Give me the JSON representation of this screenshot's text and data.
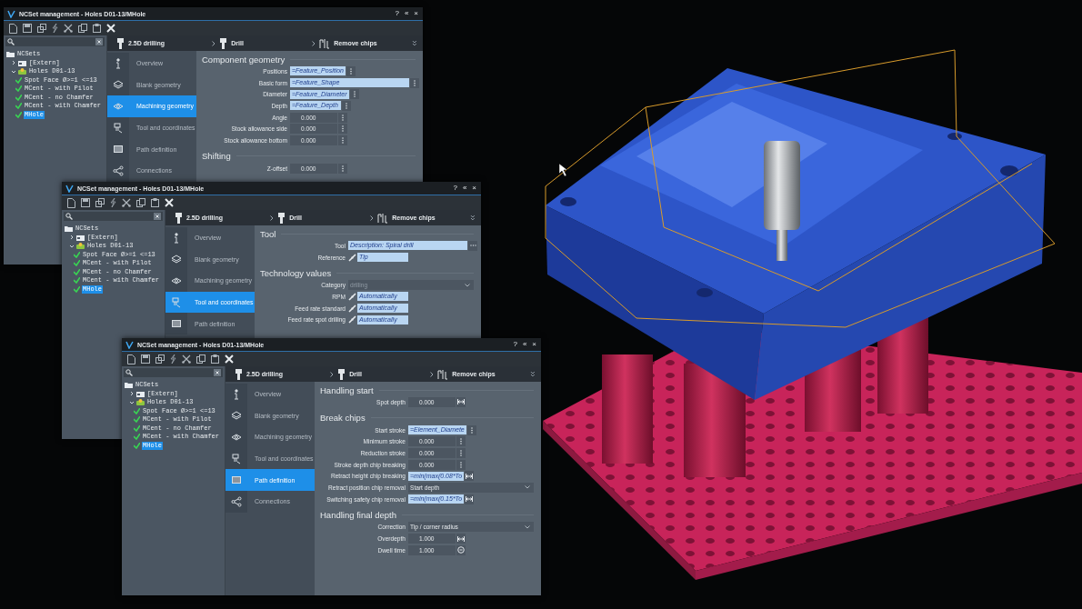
{
  "windows": [
    {
      "title": "NCSet management - Holes D01-13/MHole",
      "title_buttons": [
        "?",
        "«",
        "×"
      ],
      "tree": [
        {
          "label": "NCSets",
          "kind": "folder",
          "children": [
            {
              "label": "[Extern]",
              "kind": "extern",
              "expanded": false,
              "selected": false
            },
            {
              "label": "Holes D01-13",
              "kind": "group",
              "expanded": true,
              "selected": false,
              "children": [
                {
                  "label": "Spot Face Ø>=1 <=13",
                  "kind": "operation",
                  "selected": false
                },
                {
                  "label": "MCent - with Pilot",
                  "kind": "operation",
                  "selected": false
                },
                {
                  "label": "MCent - no Chamfer",
                  "kind": "operation",
                  "selected": false
                },
                {
                  "label": "MCent - with Chamfer",
                  "kind": "operation",
                  "selected": false
                },
                {
                  "label": "MHole",
                  "kind": "operation",
                  "selected": true
                }
              ]
            }
          ]
        }
      ],
      "steps": [
        "2.5D drilling",
        "Drill",
        "Remove chips"
      ],
      "nav": [
        {
          "label": "Overview",
          "selected": false
        },
        {
          "label": "Blank geometry",
          "selected": false
        },
        {
          "label": "Machining geometry",
          "selected": true
        },
        {
          "label": "Tool and coordinates",
          "selected": false
        },
        {
          "label": "Path definition",
          "selected": false
        },
        {
          "label": "Connections",
          "selected": false
        }
      ],
      "sections": [
        {
          "title": "Component geometry",
          "rows": [
            {
              "label": "Positions",
              "kind": "formula",
              "value": "=Feature_Position",
              "button": {
                "kind": "more"
              }
            },
            {
              "label": "Basic form",
              "kind": "formula-long",
              "value": "=Feature_Shape",
              "button": {
                "kind": "more"
              }
            },
            {
              "label": "Diameter",
              "kind": "formula",
              "value": "=Feature_Diameter",
              "button": {
                "kind": "more"
              }
            },
            {
              "label": "Depth",
              "kind": "formula",
              "value": "=Feature_Depth",
              "button": {
                "kind": "more"
              }
            },
            {
              "label": "Angle",
              "kind": "number",
              "value": "0.000",
              "button": {
                "kind": "more"
              }
            },
            {
              "label": "Stock allowance side",
              "kind": "number",
              "value": "0.000",
              "button": {
                "kind": "more"
              }
            },
            {
              "label": "Stock allowance bottom",
              "kind": "number",
              "value": "0.000",
              "button": {
                "kind": "more"
              }
            }
          ]
        },
        {
          "title": "Shifting",
          "rows": [
            {
              "label": "Z-offset",
              "kind": "number",
              "value": "0.000",
              "button": {
                "kind": "more"
              }
            }
          ]
        }
      ]
    },
    {
      "title": "NCSet management - Holes D01-13/MHole",
      "title_buttons": [
        "?",
        "«",
        "×"
      ],
      "tree": [
        {
          "label": "NCSets",
          "kind": "folder",
          "children": [
            {
              "label": "[Extern]",
              "kind": "extern",
              "expanded": false,
              "selected": false
            },
            {
              "label": "Holes D01-13",
              "kind": "group",
              "expanded": true,
              "selected": false,
              "children": [
                {
                  "label": "Spot Face Ø>=1 <=13",
                  "kind": "operation",
                  "selected": false
                },
                {
                  "label": "MCent - with Pilot",
                  "kind": "operation",
                  "selected": false
                },
                {
                  "label": "MCent - no Chamfer",
                  "kind": "operation",
                  "selected": false
                },
                {
                  "label": "MCent - with Chamfer",
                  "kind": "operation",
                  "selected": false
                },
                {
                  "label": "MHole",
                  "kind": "operation",
                  "selected": true
                }
              ]
            }
          ]
        }
      ],
      "steps": [
        "2.5D drilling",
        "Drill",
        "Remove chips"
      ],
      "nav": [
        {
          "label": "Overview",
          "selected": false
        },
        {
          "label": "Blank geometry",
          "selected": false
        },
        {
          "label": "Machining geometry",
          "selected": false
        },
        {
          "label": "Tool and coordinates",
          "selected": true
        },
        {
          "label": "Path definition",
          "selected": false
        }
      ],
      "sections": [
        {
          "title": "Tool",
          "rows": [
            {
              "label": "Tool",
              "kind": "formula-long",
              "value": "Description: Spiral drill",
              "button": {
                "kind": "browse"
              }
            },
            {
              "label": "Reference",
              "kind": "link",
              "value": "Tip"
            }
          ]
        },
        {
          "title": "Technology values",
          "rows": [
            {
              "label": "Category",
              "kind": "select",
              "value": "drilling",
              "disabled": true
            },
            {
              "label": "RPM",
              "kind": "link",
              "value": "Automatically"
            },
            {
              "label": "Feed rate standard",
              "kind": "link",
              "value": "Automatically"
            },
            {
              "label": "Feed rate spot drilling",
              "kind": "link",
              "value": "Automatically"
            }
          ]
        }
      ]
    },
    {
      "title": "NCSet management - Holes D01-13/MHole",
      "title_buttons": [
        "?",
        "«",
        "×"
      ],
      "tree": [
        {
          "label": "NCSets",
          "kind": "folder",
          "children": [
            {
              "label": "[Extern]",
              "kind": "extern",
              "expanded": false,
              "selected": false
            },
            {
              "label": "Holes D01-13",
              "kind": "group",
              "expanded": true,
              "selected": false,
              "children": [
                {
                  "label": "Spot Face Ø>=1 <=13",
                  "kind": "operation",
                  "selected": false
                },
                {
                  "label": "MCent - with Pilot",
                  "kind": "operation",
                  "selected": false
                },
                {
                  "label": "MCent - no Chamfer",
                  "kind": "operation",
                  "selected": false
                },
                {
                  "label": "MCent - with Chamfer",
                  "kind": "operation",
                  "selected": false
                },
                {
                  "label": "MHole",
                  "kind": "operation",
                  "selected": true
                }
              ]
            }
          ]
        }
      ],
      "steps": [
        "2.5D drilling",
        "Drill",
        "Remove chips"
      ],
      "nav": [
        {
          "label": "Overview",
          "selected": false
        },
        {
          "label": "Blank geometry",
          "selected": false
        },
        {
          "label": "Machining geometry",
          "selected": false
        },
        {
          "label": "Tool and coordinates",
          "selected": false
        },
        {
          "label": "Path definition",
          "selected": true
        },
        {
          "label": "Connections",
          "selected": false
        }
      ],
      "sections": [
        {
          "title": "Handling start",
          "rows": [
            {
              "label": "Spot depth",
              "kind": "number",
              "value": "0.000",
              "button": {
                "kind": "measure"
              }
            }
          ]
        },
        {
          "title": "Break chips",
          "rows": [
            {
              "label": "Start stroke",
              "kind": "formula",
              "value": "=Element_Diamete",
              "button": {
                "kind": "more"
              }
            },
            {
              "label": "Minimum stroke",
              "kind": "number",
              "value": "0.000",
              "button": {
                "kind": "more"
              }
            },
            {
              "label": "Reduction stroke",
              "kind": "number",
              "value": "0.000",
              "button": {
                "kind": "more"
              }
            },
            {
              "label": "Stroke depth chip breaking",
              "kind": "number",
              "value": "0.000",
              "button": {
                "kind": "more"
              }
            },
            {
              "label": "Retract height chip breaking",
              "kind": "formula",
              "value": "=min(max(0.08*To",
              "button": {
                "kind": "measure"
              }
            },
            {
              "label": "Retract position chip removal",
              "kind": "select",
              "value": "Start depth",
              "disabled": false
            },
            {
              "label": "Switching safety chip removal",
              "kind": "formula",
              "value": "=min(max(0.15*To",
              "button": {
                "kind": "measure"
              }
            }
          ]
        },
        {
          "title": "Handling final depth",
          "rows": [
            {
              "label": "Correction",
              "kind": "select",
              "value": "Tip / corner radius",
              "disabled": false
            },
            {
              "label": "Overdepth",
              "kind": "number",
              "value": "1.000",
              "button": {
                "kind": "measure"
              }
            },
            {
              "label": "Dwell time",
              "kind": "number",
              "value": "1.000",
              "button": {
                "kind": "timer"
              }
            }
          ]
        }
      ]
    }
  ]
}
